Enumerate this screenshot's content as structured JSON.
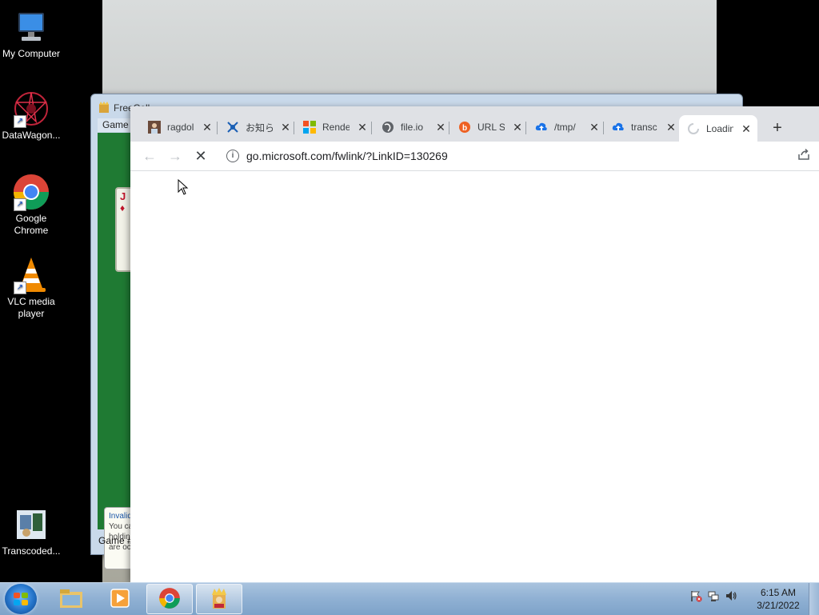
{
  "desktop": {
    "icons": [
      {
        "label": "My Computer"
      },
      {
        "label": "DataWagon..."
      },
      {
        "label": "Google Chrome"
      },
      {
        "label": "VLC media player"
      },
      {
        "label": "Transcoded..."
      }
    ]
  },
  "freecell": {
    "title": "FreeCell",
    "menu_game": "Game",
    "message_title": "Invalid",
    "message_lines": [
      "You ca",
      "holdin",
      "are occ"
    ],
    "status": "Game #"
  },
  "browser": {
    "tabs": [
      {
        "label": "ragdoll",
        "icon": "avatar-icon"
      },
      {
        "label": "お知らせ",
        "icon": "network-icon"
      },
      {
        "label": "Render",
        "icon": "microsoft-icon"
      },
      {
        "label": "file.io",
        "icon": "globe-icon"
      },
      {
        "label": "URL S",
        "icon": "bitly-icon"
      },
      {
        "label": "/tmp/",
        "icon": "cloud-upload-icon"
      },
      {
        "label": "transc",
        "icon": "cloud-upload-icon"
      },
      {
        "label": "Loading",
        "icon": "loading-spinner-icon",
        "active": true
      }
    ],
    "new_tab_symbol": "+",
    "url": "go.microsoft.com/fwlink/?LinkID=130269"
  },
  "taskbar": {
    "clock_time": "6:15 AM",
    "clock_date": "3/21/2022"
  },
  "colors": {
    "accent": "#1a73e8",
    "taskbar": "#8fb0d3",
    "felt": "#1f7a33"
  }
}
